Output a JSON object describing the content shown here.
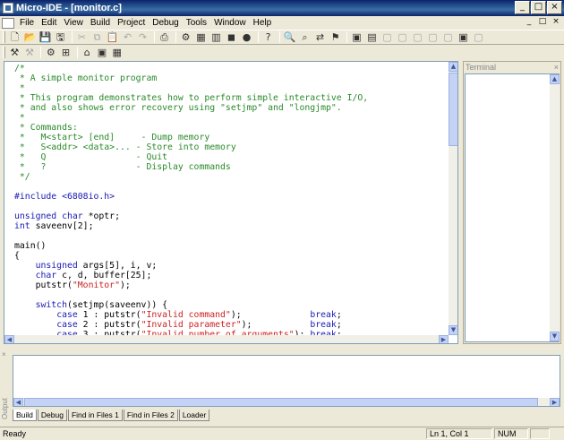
{
  "window": {
    "title": "Micro-IDE - [monitor.c]",
    "min_glyph": "_",
    "max_glyph": "□",
    "close_glyph": "×"
  },
  "menu": {
    "items": [
      {
        "label": "File"
      },
      {
        "label": "Edit"
      },
      {
        "label": "View"
      },
      {
        "label": "Build"
      },
      {
        "label": "Project"
      },
      {
        "label": "Debug"
      },
      {
        "label": "Tools"
      },
      {
        "label": "Window"
      },
      {
        "label": "Help"
      }
    ]
  },
  "toolbar1": [
    {
      "icon": "new-file-icon",
      "glyph": "🗋"
    },
    {
      "icon": "open-folder-icon",
      "glyph": "📂"
    },
    {
      "icon": "save-icon",
      "glyph": "💾"
    },
    {
      "icon": "save-all-icon",
      "glyph": "🖫"
    },
    {
      "sep": true
    },
    {
      "icon": "cut-icon",
      "glyph": "✂",
      "dim": true
    },
    {
      "icon": "copy-icon",
      "glyph": "⧉",
      "dim": true
    },
    {
      "icon": "paste-icon",
      "glyph": "📋",
      "dim": true
    },
    {
      "icon": "undo-icon",
      "glyph": "↶",
      "dim": true
    },
    {
      "icon": "redo-icon",
      "glyph": "↷",
      "dim": true
    },
    {
      "sep": true
    },
    {
      "icon": "print-icon",
      "glyph": "⎙"
    },
    {
      "sep": true
    },
    {
      "icon": "compile-icon",
      "glyph": "⚙"
    },
    {
      "icon": "build-icon",
      "glyph": "▦"
    },
    {
      "icon": "rebuild-icon",
      "glyph": "▥"
    },
    {
      "icon": "stop-build-icon",
      "glyph": "◼"
    },
    {
      "icon": "run-icon",
      "glyph": "●"
    },
    {
      "sep": true
    },
    {
      "icon": "help-icon",
      "glyph": "?"
    },
    {
      "sep": true
    },
    {
      "icon": "find-icon",
      "glyph": "🔍"
    },
    {
      "icon": "find-in-files-icon",
      "glyph": "⌕"
    },
    {
      "icon": "replace-icon",
      "glyph": "⇄"
    },
    {
      "icon": "bookmark-icon",
      "glyph": "⚑"
    },
    {
      "sep": true
    },
    {
      "icon": "workspace-icon",
      "glyph": "▣"
    },
    {
      "icon": "output-window-icon",
      "glyph": "▤"
    },
    {
      "icon": "watch-icon",
      "glyph": "▢",
      "dim": true
    },
    {
      "icon": "variables-icon",
      "glyph": "▢",
      "dim": true
    },
    {
      "icon": "registers-icon",
      "glyph": "▢",
      "dim": true
    },
    {
      "icon": "memory-icon",
      "glyph": "▢",
      "dim": true
    },
    {
      "icon": "call-stack-icon",
      "glyph": "▢",
      "dim": true
    },
    {
      "icon": "terminal-icon",
      "glyph": "▣"
    },
    {
      "icon": "disassembly-icon",
      "glyph": "▢",
      "dim": true
    }
  ],
  "toolbar2": [
    {
      "icon": "debug-build-icon",
      "glyph": "⚒"
    },
    {
      "icon": "debug-build-dim-icon",
      "glyph": "⚒",
      "dim": true
    },
    {
      "sep": true
    },
    {
      "icon": "project-settings-icon",
      "glyph": "⚙"
    },
    {
      "icon": "project-add-icon",
      "glyph": "⊞"
    },
    {
      "sep": true
    },
    {
      "icon": "project-home-icon",
      "glyph": "⌂"
    },
    {
      "icon": "project-window-icon",
      "glyph": "▣"
    },
    {
      "icon": "project-config-icon",
      "glyph": "▦"
    }
  ],
  "editor": {
    "lines": [
      [
        {
          "t": "/*",
          "c": "c"
        }
      ],
      [
        {
          "t": " * A simple monitor program",
          "c": "c"
        }
      ],
      [
        {
          "t": " *",
          "c": "c"
        }
      ],
      [
        {
          "t": " * This program demonstrates how to perform simple interactive I/O,",
          "c": "c"
        }
      ],
      [
        {
          "t": " * and also shows error recovery using \"setjmp\" and \"longjmp\".",
          "c": "c"
        }
      ],
      [
        {
          "t": " *",
          "c": "c"
        }
      ],
      [
        {
          "t": " * Commands:",
          "c": "c"
        }
      ],
      [
        {
          "t": " *   M<start> [end]     - Dump memory",
          "c": "c"
        }
      ],
      [
        {
          "t": " *   S<addr> <data>... - Store into memory",
          "c": "c"
        }
      ],
      [
        {
          "t": " *   Q                 - Quit",
          "c": "c"
        }
      ],
      [
        {
          "t": " *   ?                 - Display commands",
          "c": "c"
        }
      ],
      [
        {
          "t": " */",
          "c": "c"
        }
      ],
      [
        {
          "t": ""
        }
      ],
      [
        {
          "t": "#include <6808io.h>",
          "c": "k"
        }
      ],
      [
        {
          "t": ""
        }
      ],
      [
        {
          "t": "unsigned char",
          "c": "k"
        },
        {
          "t": " *optr;"
        }
      ],
      [
        {
          "t": "int",
          "c": "k"
        },
        {
          "t": " saveenv[2];"
        }
      ],
      [
        {
          "t": ""
        }
      ],
      [
        {
          "t": "main()"
        }
      ],
      [
        {
          "t": "{"
        }
      ],
      [
        {
          "t": "    "
        },
        {
          "t": "unsigned",
          "c": "k"
        },
        {
          "t": " args[5], i, v;"
        }
      ],
      [
        {
          "t": "    "
        },
        {
          "t": "char",
          "c": "k"
        },
        {
          "t": " c, d, buffer[25];"
        }
      ],
      [
        {
          "t": "    putstr("
        },
        {
          "t": "\"Monitor\"",
          "c": "s"
        },
        {
          "t": ");"
        }
      ],
      [
        {
          "t": ""
        }
      ],
      [
        {
          "t": "    "
        },
        {
          "t": "switch",
          "c": "k"
        },
        {
          "t": "(setjmp(saveenv)) {"
        }
      ],
      [
        {
          "t": "        "
        },
        {
          "t": "case",
          "c": "k"
        },
        {
          "t": " 1 : putstr("
        },
        {
          "t": "\"Invalid command\"",
          "c": "s"
        },
        {
          "t": ");             "
        },
        {
          "t": "break",
          "c": "k"
        },
        {
          "t": ";"
        }
      ],
      [
        {
          "t": "        "
        },
        {
          "t": "case",
          "c": "k"
        },
        {
          "t": " 2 : putstr("
        },
        {
          "t": "\"Invalid parameter\"",
          "c": "s"
        },
        {
          "t": ");           "
        },
        {
          "t": "break",
          "c": "k"
        },
        {
          "t": ";"
        }
      ],
      [
        {
          "t": "        "
        },
        {
          "t": "case",
          "c": "k"
        },
        {
          "t": " 3 : putstr("
        },
        {
          "t": "\"Invalid number of arguments\"",
          "c": "s"
        },
        {
          "t": "); "
        },
        {
          "t": "break",
          "c": "k"
        },
        {
          "t": ";"
        }
      ]
    ]
  },
  "terminal": {
    "title": "Terminal",
    "close_glyph": "×"
  },
  "output": {
    "side_label": "Output",
    "close_glyph": "×",
    "tabs": [
      {
        "label": "Build",
        "active": true
      },
      {
        "label": "Debug"
      },
      {
        "label": "Find in Files 1"
      },
      {
        "label": "Find in Files 2"
      },
      {
        "label": "Loader"
      }
    ]
  },
  "status": {
    "text": "Ready",
    "position": "Ln 1, Col 1",
    "num": "NUM"
  }
}
